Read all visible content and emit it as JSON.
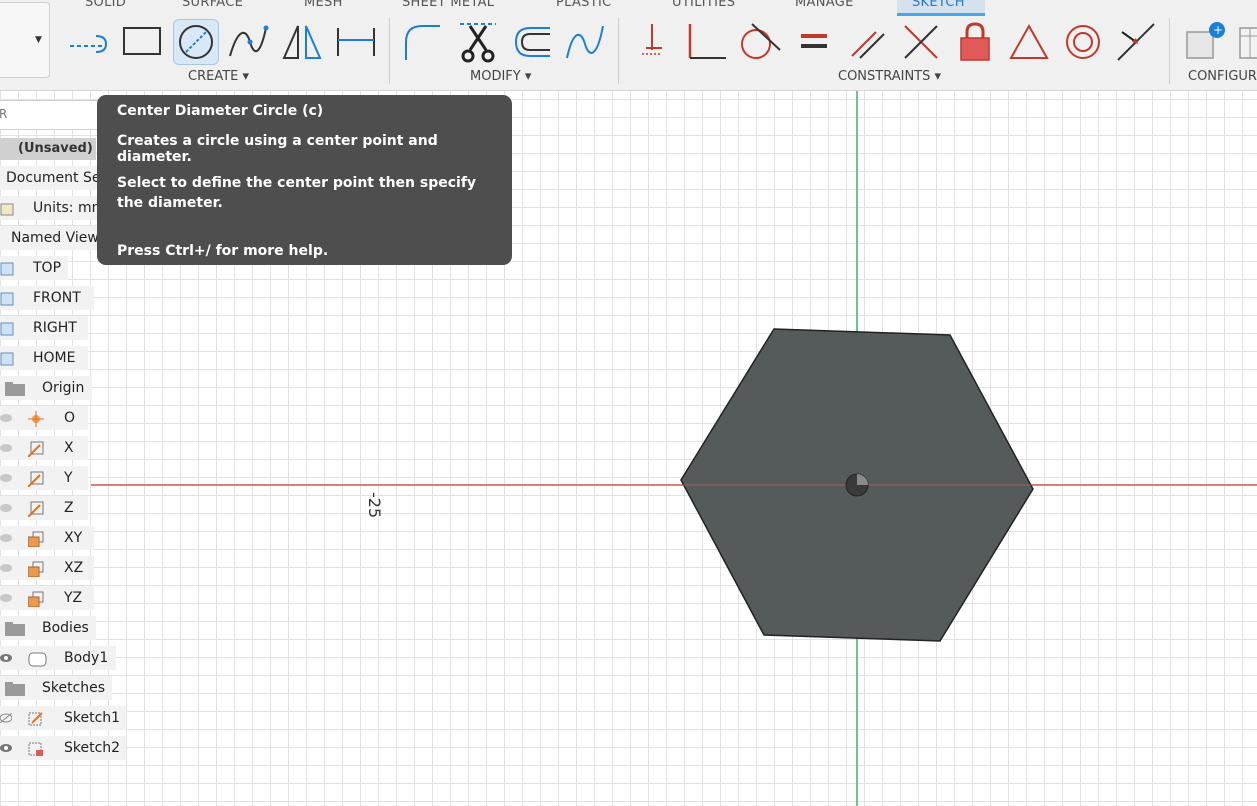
{
  "tabs": [
    "SOLID",
    "SURFACE",
    "MESH",
    "SHEET METAL",
    "PLASTIC",
    "UTILITIES",
    "MANAGE",
    "SKETCH"
  ],
  "active_tab": "SKETCH",
  "groups": {
    "create": "CREATE ▾",
    "modify": "MODIFY ▾",
    "constraints": "CONSTRAINTS ▾",
    "configure": "CONFIGUR"
  },
  "tooltip": {
    "title": "Center Diameter Circle (c)",
    "line1": "Creates a circle using a center point and diameter.",
    "line2": "Select to define the center point then specify the diameter.",
    "line3": "Press Ctrl+/ for more help."
  },
  "browser": {
    "search_letter": "R",
    "document_title": "(Unsaved)",
    "items": {
      "document_settings": "Document Sett",
      "units": "Units: mm",
      "named_views": "Named Views",
      "top": "TOP",
      "front": "FRONT",
      "right": "RIGHT",
      "home": "HOME",
      "origin": "Origin",
      "o": "O",
      "x": "X",
      "y": "Y",
      "z": "Z",
      "xy": "XY",
      "xz": "XZ",
      "yz": "YZ",
      "bodies": "Bodies",
      "body1": "Body1",
      "sketches": "Sketches",
      "sketch1": "Sketch1",
      "sketch2": "Sketch2"
    }
  },
  "dimension_value": "-25",
  "colors": {
    "accent": "#1b7fd6",
    "constraint_red": "#c0392b",
    "axis_red": "#d9534f",
    "axis_green": "#3cb371",
    "hexagon_fill": "#555a5a"
  }
}
